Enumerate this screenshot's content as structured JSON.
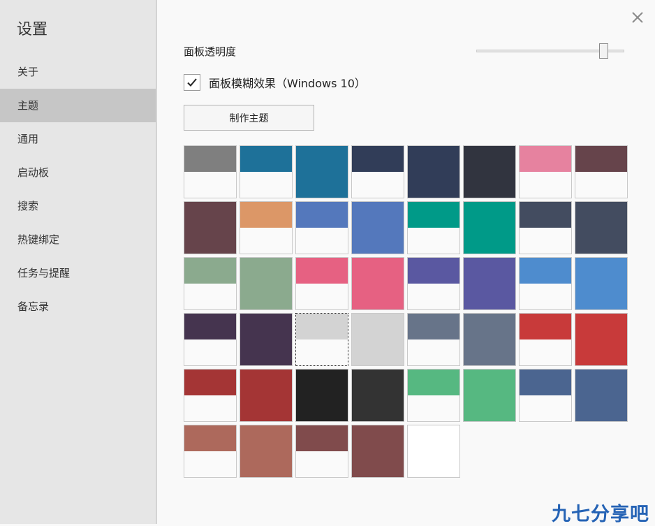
{
  "sidebar": {
    "title": "设置",
    "items": [
      {
        "label": "关于",
        "active": false
      },
      {
        "label": "主题",
        "active": true
      },
      {
        "label": "通用",
        "active": false
      },
      {
        "label": "启动板",
        "active": false
      },
      {
        "label": "搜索",
        "active": false
      },
      {
        "label": "热键绑定",
        "active": false
      },
      {
        "label": "任务与提醒",
        "active": false
      },
      {
        "label": "备忘录",
        "active": false
      }
    ]
  },
  "panel": {
    "close_icon": "close-icon",
    "opacity_label": "面板透明度",
    "opacity_value": 0.86,
    "blur_checked": true,
    "blur_label": "面板模糊效果（Windows 10）",
    "make_theme_label": "制作主题"
  },
  "themes": [
    {
      "color": "#7f7f7f",
      "style": "split"
    },
    {
      "color": "#1e7199",
      "style": "split"
    },
    {
      "color": "#1e7199",
      "style": "full"
    },
    {
      "color": "#313d58",
      "style": "split"
    },
    {
      "color": "#313d58",
      "style": "full"
    },
    {
      "color": "#31343f",
      "style": "full"
    },
    {
      "color": "#e6829f",
      "style": "split"
    },
    {
      "color": "#66444b",
      "style": "split"
    },
    {
      "color": "#66444b",
      "style": "full"
    },
    {
      "color": "#dc9767",
      "style": "split"
    },
    {
      "color": "#5478bc",
      "style": "split"
    },
    {
      "color": "#5478bc",
      "style": "full"
    },
    {
      "color": "#009a88",
      "style": "split"
    },
    {
      "color": "#009a88",
      "style": "full"
    },
    {
      "color": "#434c60",
      "style": "split"
    },
    {
      "color": "#434c60",
      "style": "full"
    },
    {
      "color": "#8baa8e",
      "style": "split"
    },
    {
      "color": "#8baa8e",
      "style": "full"
    },
    {
      "color": "#e66182",
      "style": "split"
    },
    {
      "color": "#e66182",
      "style": "full"
    },
    {
      "color": "#5a58a1",
      "style": "split"
    },
    {
      "color": "#5a58a1",
      "style": "full"
    },
    {
      "color": "#4e8cce",
      "style": "split"
    },
    {
      "color": "#4e8cce",
      "style": "full"
    },
    {
      "color": "#45344f",
      "style": "split"
    },
    {
      "color": "#45344f",
      "style": "full"
    },
    {
      "color": "#d3d3d3",
      "style": "split",
      "selected": true
    },
    {
      "color": "#d3d3d3",
      "style": "full"
    },
    {
      "color": "#677489",
      "style": "split"
    },
    {
      "color": "#677489",
      "style": "full"
    },
    {
      "color": "#c83a3a",
      "style": "split"
    },
    {
      "color": "#c83a3a",
      "style": "full"
    },
    {
      "color": "#a43535",
      "style": "split"
    },
    {
      "color": "#a43535",
      "style": "full"
    },
    {
      "color": "#222222",
      "style": "full"
    },
    {
      "color": "#333333",
      "style": "full"
    },
    {
      "color": "#56b881",
      "style": "split"
    },
    {
      "color": "#56b881",
      "style": "full"
    },
    {
      "color": "#4b6590",
      "style": "split"
    },
    {
      "color": "#4b6590",
      "style": "full"
    },
    {
      "color": "#ad695c",
      "style": "split"
    },
    {
      "color": "#ad695c",
      "style": "full"
    },
    {
      "color": "#804b4c",
      "style": "split"
    },
    {
      "color": "#804b4c",
      "style": "full"
    },
    {
      "color": "#ffffff",
      "style": "full"
    }
  ],
  "watermark": "九七分享吧"
}
